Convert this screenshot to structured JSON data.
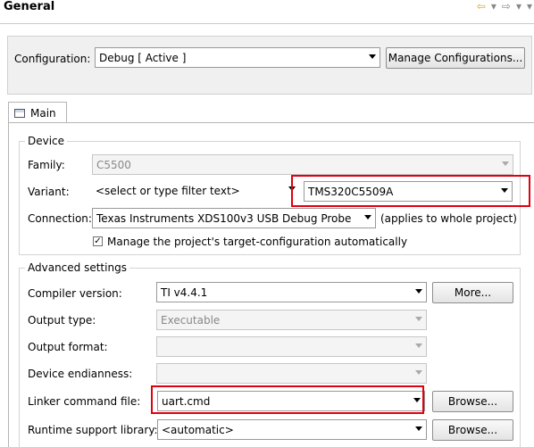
{
  "header": {
    "title": "General",
    "nav": [
      "⇦",
      "▾",
      "⇨",
      "▾",
      "▾"
    ]
  },
  "config": {
    "label": "Configuration:",
    "value": "Debug  [ Active ]",
    "manage_btn": "Manage Configurations..."
  },
  "tab": {
    "label": "Main"
  },
  "device": {
    "legend": "Device",
    "family_label": "Family:",
    "family_value": "C5500",
    "variant_label": "Variant:",
    "variant_filter": "<select or type filter text>",
    "variant_value": "TMS320C5509A",
    "connection_label": "Connection:",
    "connection_value": "Texas Instruments XDS100v3 USB Debug Probe",
    "connection_note": "(applies to whole project)",
    "manage_check_label": "Manage the project's target-configuration automatically"
  },
  "advanced": {
    "legend": "Advanced settings",
    "compiler_label": "Compiler version:",
    "compiler_value": "TI v4.4.1",
    "more_btn": "More...",
    "output_type_label": "Output type:",
    "output_type_value": "Executable",
    "output_format_label": "Output format:",
    "output_format_value": "",
    "endianness_label": "Device endianness:",
    "endianness_value": "",
    "linker_label": "Linker command file:",
    "linker_value": "uart.cmd",
    "linker_browse": "Browse...",
    "rts_label": "Runtime support library:",
    "rts_value": "<automatic>",
    "rts_browse": "Browse..."
  },
  "colors": {
    "highlight": "#e0000f",
    "panel_bg": "#f0f0f0"
  }
}
